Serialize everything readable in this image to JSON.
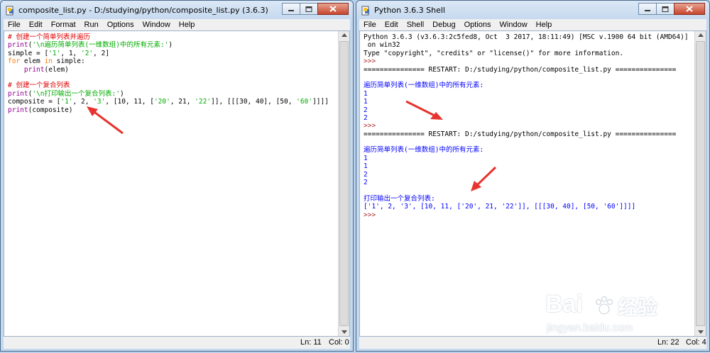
{
  "left_window": {
    "title": "composite_list.py - D:/studying/python/composite_list.py (3.6.3)",
    "menu": [
      "File",
      "Edit",
      "Format",
      "Run",
      "Options",
      "Window",
      "Help"
    ],
    "code_lines": [
      [
        {
          "t": "# 创建一个简单列表并遍历",
          "c": "comment"
        }
      ],
      [
        {
          "t": "print",
          "c": "builtin"
        },
        {
          "t": "(",
          "c": "plain"
        },
        {
          "t": "'\\n遍历简单列表(一维数组)中的所有元素:'",
          "c": "str"
        },
        {
          "t": ")",
          "c": "plain"
        }
      ],
      [
        {
          "t": "simple = [",
          "c": "plain"
        },
        {
          "t": "'1'",
          "c": "str"
        },
        {
          "t": ", 1, ",
          "c": "plain"
        },
        {
          "t": "'2'",
          "c": "str"
        },
        {
          "t": ", 2]",
          "c": "plain"
        }
      ],
      [
        {
          "t": "for",
          "c": "kw"
        },
        {
          "t": " elem ",
          "c": "plain"
        },
        {
          "t": "in",
          "c": "kw"
        },
        {
          "t": " simple:",
          "c": "plain"
        }
      ],
      [
        {
          "t": "    ",
          "c": "plain"
        },
        {
          "t": "print",
          "c": "builtin"
        },
        {
          "t": "(elem)",
          "c": "plain"
        }
      ],
      [
        {
          "t": "",
          "c": "plain"
        }
      ],
      [
        {
          "t": "# 创建一个复合列表",
          "c": "comment"
        }
      ],
      [
        {
          "t": "print",
          "c": "builtin"
        },
        {
          "t": "(",
          "c": "plain"
        },
        {
          "t": "'\\n打印输出一个复合列表:'",
          "c": "str"
        },
        {
          "t": ")",
          "c": "plain"
        }
      ],
      [
        {
          "t": "composite = [",
          "c": "plain"
        },
        {
          "t": "'1'",
          "c": "str"
        },
        {
          "t": ", 2, ",
          "c": "plain"
        },
        {
          "t": "'3'",
          "c": "str"
        },
        {
          "t": ", [10, 11, [",
          "c": "plain"
        },
        {
          "t": "'20'",
          "c": "str"
        },
        {
          "t": ", 21, ",
          "c": "plain"
        },
        {
          "t": "'22'",
          "c": "str"
        },
        {
          "t": "]], [[[30, 40], [50, ",
          "c": "plain"
        },
        {
          "t": "'60'",
          "c": "str"
        },
        {
          "t": "]]]]",
          "c": "plain"
        }
      ],
      [
        {
          "t": "print",
          "c": "builtin"
        },
        {
          "t": "(composite)",
          "c": "plain"
        }
      ]
    ],
    "status": {
      "ln": "Ln: 11",
      "col": "Col: 0"
    }
  },
  "right_window": {
    "title": "Python 3.6.3 Shell",
    "menu": [
      "File",
      "Edit",
      "Shell",
      "Debug",
      "Options",
      "Window",
      "Help"
    ],
    "shell_lines": [
      [
        {
          "t": "Python 3.6.3 (v3.6.3:2c5fed8, Oct  3 2017, 18:11:49) [MSC v.1900 64 bit (AMD64)]",
          "c": "plain"
        }
      ],
      [
        {
          "t": " on win32",
          "c": "plain"
        }
      ],
      [
        {
          "t": "Type \"copyright\", \"credits\" or \"license()\" for more information.",
          "c": "plain"
        }
      ],
      [
        {
          "t": ">>> ",
          "c": "prompt"
        }
      ],
      [
        {
          "t": "=============== RESTART: D:/studying/python/composite_list.py ===============",
          "c": "plain"
        }
      ],
      [
        {
          "t": "",
          "c": "plain"
        }
      ],
      [
        {
          "t": "遍历简单列表(一维数组)中的所有元素:",
          "c": "out"
        }
      ],
      [
        {
          "t": "1",
          "c": "out"
        }
      ],
      [
        {
          "t": "1",
          "c": "out"
        }
      ],
      [
        {
          "t": "2",
          "c": "out"
        }
      ],
      [
        {
          "t": "2",
          "c": "out"
        }
      ],
      [
        {
          "t": ">>> ",
          "c": "prompt"
        }
      ],
      [
        {
          "t": "=============== RESTART: D:/studying/python/composite_list.py ===============",
          "c": "plain"
        }
      ],
      [
        {
          "t": "",
          "c": "plain"
        }
      ],
      [
        {
          "t": "遍历简单列表(一维数组)中的所有元素:",
          "c": "out"
        }
      ],
      [
        {
          "t": "1",
          "c": "out"
        }
      ],
      [
        {
          "t": "1",
          "c": "out"
        }
      ],
      [
        {
          "t": "2",
          "c": "out"
        }
      ],
      [
        {
          "t": "2",
          "c": "out"
        }
      ],
      [
        {
          "t": "",
          "c": "plain"
        }
      ],
      [
        {
          "t": "打印输出一个复合列表:",
          "c": "out"
        }
      ],
      [
        {
          "t": "['1', 2, '3', [10, 11, ['20', 21, '22']], [[[30, 40], [50, '60']]]]",
          "c": "out"
        }
      ],
      [
        {
          "t": ">>> ",
          "c": "prompt"
        }
      ]
    ],
    "status": {
      "ln": "Ln: 22",
      "col": "Col: 4"
    }
  },
  "watermark": {
    "logo_text": "Bai",
    "logo_cn": "经验",
    "url": "jingyan.baidu.com"
  },
  "colors": {
    "arrow": "#e8332e",
    "comment": "#dd0000",
    "keyword": "#ff7700",
    "string": "#00aa00",
    "output": "#0000ff",
    "prompt": "#a52a2a"
  }
}
